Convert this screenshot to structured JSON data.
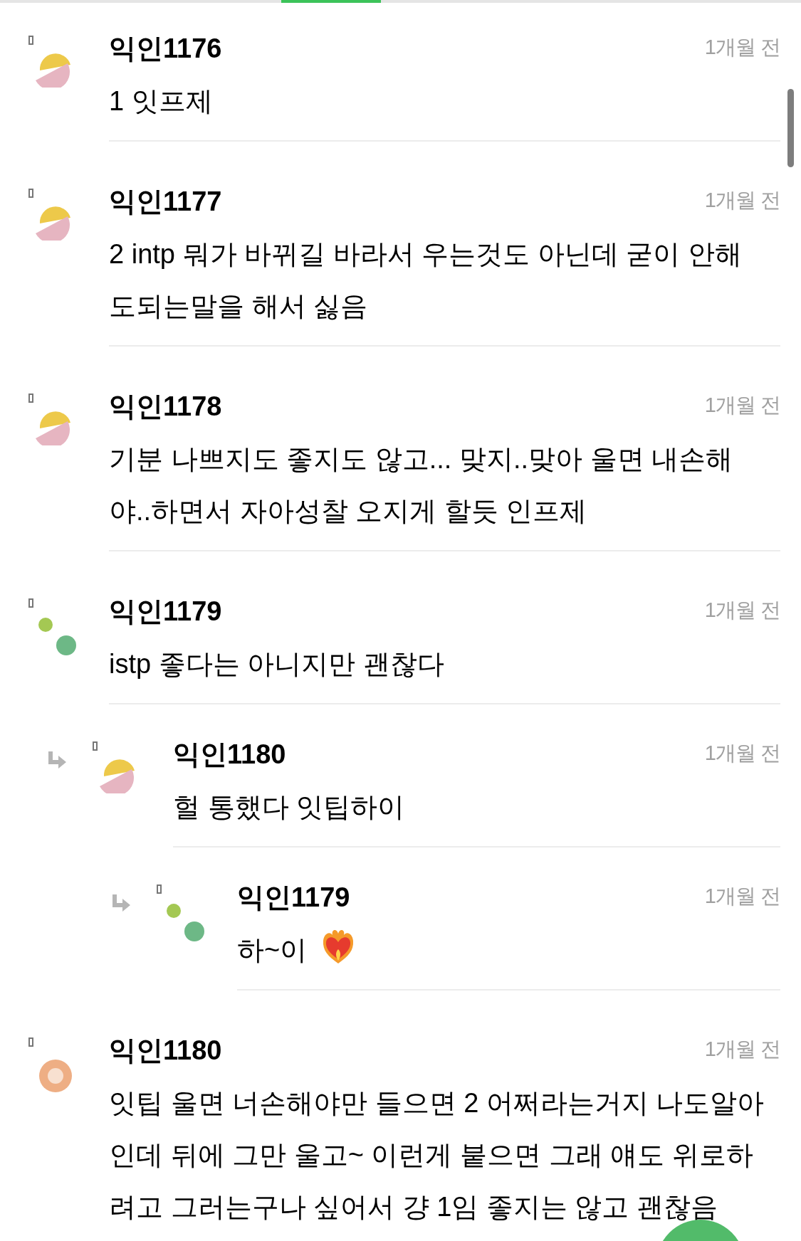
{
  "comments": [
    {
      "author": "익인1176",
      "time": "1개월 전",
      "avatar": {
        "kind": "split"
      },
      "lines": [
        "1 잇프제"
      ]
    },
    {
      "author": "익인1177",
      "time": "1개월 전",
      "avatar": {
        "kind": "split"
      },
      "lines": [
        "2 intp 뭐가 바뀌길 바라서 우는것도 아닌데 굳이 안해",
        "도되는말을 해서 싫음"
      ]
    },
    {
      "author": "익인1178",
      "time": "1개월 전",
      "avatar": {
        "kind": "split"
      },
      "lines": [
        "기분 나쁘지도 좋지도 않고... 맞지..맞아 울면 내손해",
        "야..하면서 자아성찰 오지게 할듯 인프제"
      ]
    },
    {
      "author": "익인1179",
      "time": "1개월 전",
      "avatar": {
        "kind": "dots"
      },
      "lines": [
        "istp 좋다는 아니지만 괜찮다"
      ],
      "children": [
        {
          "author": "익인1180",
          "time": "1개월 전",
          "avatar": {
            "kind": "split"
          },
          "lines": [
            "헐 통했다 잇팁하이"
          ],
          "children": [
            {
              "author": "익인1179",
              "time": "1개월 전",
              "avatar": {
                "kind": "dots"
              },
              "lines": [
                "하~이"
              ],
              "emoji": {
                "kind": "fire-heart"
              }
            }
          ]
        }
      ]
    },
    {
      "author": "익인1180",
      "time": "1개월 전",
      "avatar": {
        "kind": "ring"
      },
      "lines": [
        "잇팁 울면 너손해야만 들으면 2 어쩌라는거지 나도알아",
        "인데 뒤에 그만 울고~ 이런게 붙으면 그래 얘도 위로하",
        "려고 그러는구나 싶어서 걍 1임 좋지는 않고 괜찮음"
      ]
    }
  ]
}
